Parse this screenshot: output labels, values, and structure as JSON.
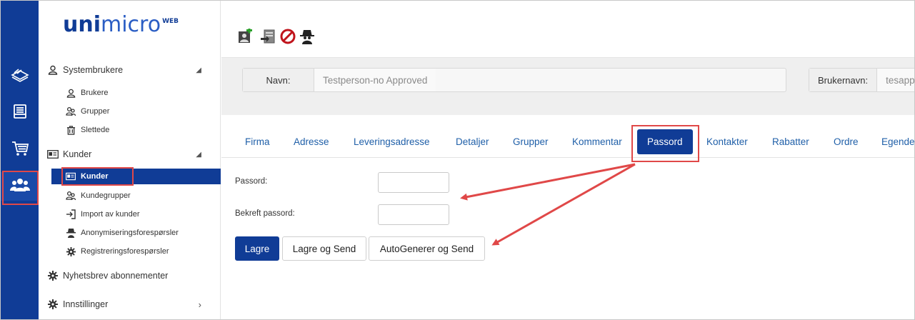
{
  "logo": {
    "uni": "uni",
    "micro": "micro",
    "web": "WEB"
  },
  "rail": {
    "items": [
      {
        "icon": "papers-icon"
      },
      {
        "icon": "inbox-icon"
      },
      {
        "icon": "cart-icon"
      },
      {
        "icon": "people-icon",
        "active": true
      }
    ]
  },
  "sidebar": {
    "systembrukere": "Systembrukere",
    "brukere": "Brukere",
    "grupper": "Grupper",
    "slettede": "Slettede",
    "kunder_group": "Kunder",
    "kunder": "Kunder",
    "kundegrupper": "Kundegrupper",
    "import": "Import av kunder",
    "anonymisering": "Anonymiseringsforespørsler",
    "registrering": "Registreringsforespørsler",
    "nyhetsbrev": "Nyhetsbrev abonnementer",
    "innstillinger": "Innstillinger"
  },
  "toolbar": {
    "buttons": [
      "add-user-icon",
      "import-icon",
      "block-icon",
      "spy-icon"
    ]
  },
  "info": {
    "navn_label": "Navn:",
    "navn_value": "Testperson-no Approved",
    "brukernavn_label": "Brukernavn:",
    "brukernavn_value": "tesapp"
  },
  "tabs": [
    "Firma",
    "Adresse",
    "Leveringsadresse",
    "Detaljer",
    "Grupper",
    "Kommentar",
    "Passord",
    "Kontakter",
    "Rabatter",
    "Ordre",
    "Egende"
  ],
  "active_tab": "Passord",
  "form": {
    "passord_label": "Passord:",
    "passord_value": "",
    "bekreft_label": "Bekreft passord:",
    "bekreft_value": ""
  },
  "buttons": {
    "lagre": "Lagre",
    "lagre_send": "Lagre og Send",
    "autogen": "AutoGenerer og Send"
  },
  "colors": {
    "brand": "#103c96",
    "highlight": "#e04848",
    "link": "#1f5fa8"
  }
}
